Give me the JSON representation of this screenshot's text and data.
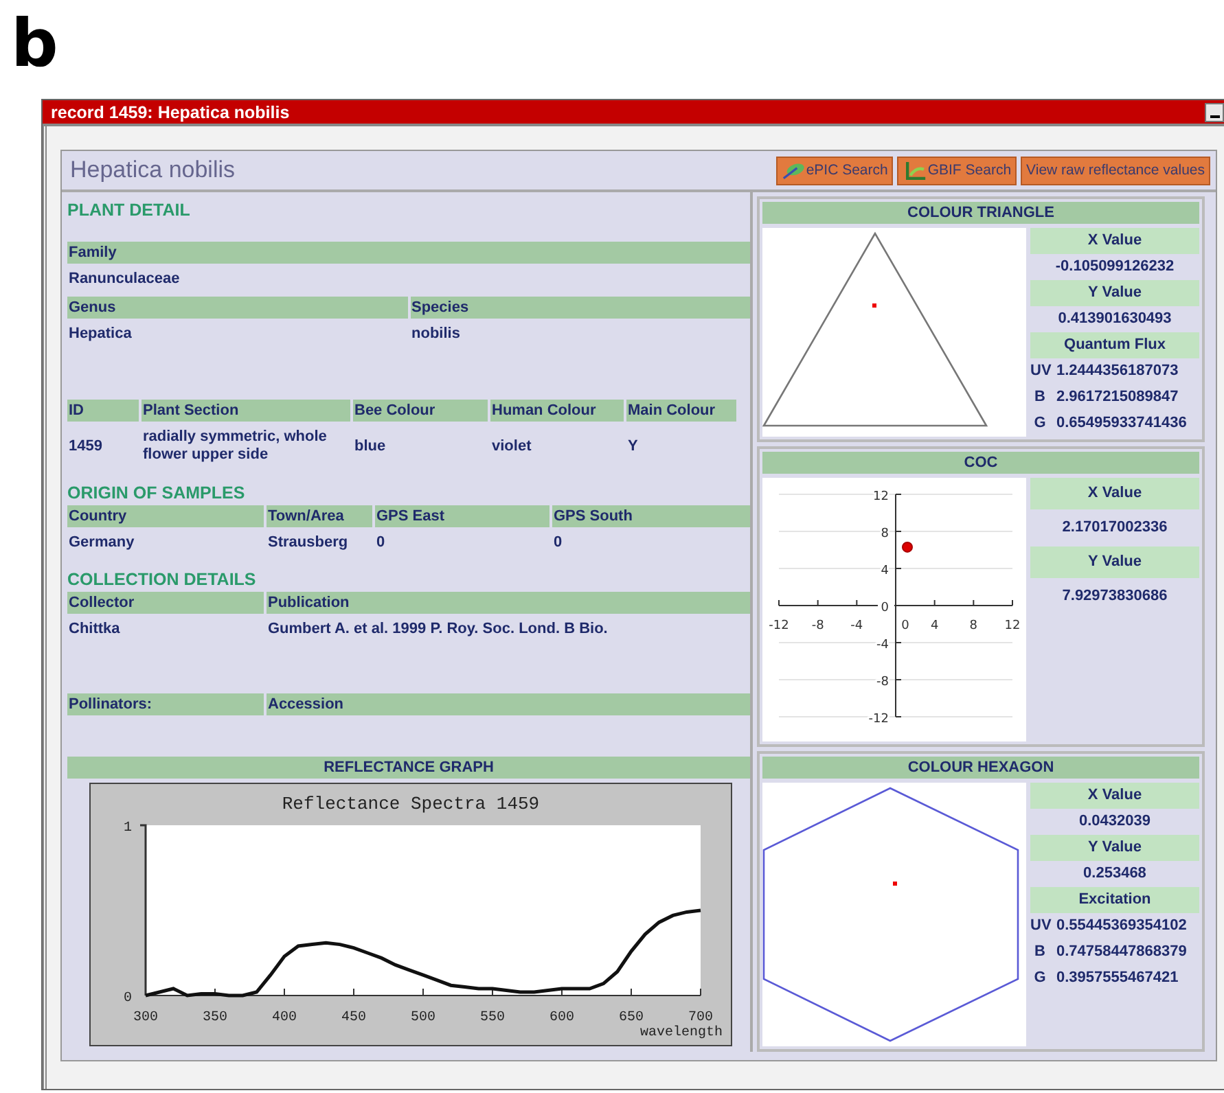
{
  "figure_label": "b",
  "window": {
    "title": "record 1459: Hepatica nobilis"
  },
  "header": {
    "title": "Hepatica nobilis",
    "buttons": [
      {
        "label": "ePIC Search",
        "kind": "epic"
      },
      {
        "label": "GBIF Search",
        "kind": "gbif"
      },
      {
        "label": "View raw reflectance values",
        "kind": "plain"
      }
    ]
  },
  "sections": [
    {
      "heading": "PLANT DETAIL",
      "tables": [
        {
          "columns": [
            "Family"
          ],
          "values": [
            "Ranunculaceae"
          ]
        },
        {
          "columns": [
            "Genus",
            "Species"
          ],
          "values": [
            "Hepatica",
            "nobilis"
          ]
        },
        {
          "columns": [
            "ID",
            "Plant Section",
            "Bee Colour",
            "Human Colour",
            "Main Colour"
          ],
          "values": [
            "1459",
            "radially symmetric, whole flower upper side",
            "blue",
            "violet",
            "Y"
          ]
        }
      ]
    },
    {
      "heading": "ORIGIN OF SAMPLES",
      "tables": [
        {
          "columns": [
            "Country",
            "Town/Area",
            "GPS East",
            "GPS South"
          ],
          "values": [
            "Germany",
            "Strausberg",
            "0",
            "0"
          ]
        }
      ]
    },
    {
      "heading": "COLLECTION DETAILS",
      "tables": [
        {
          "columns": [
            "Collector",
            "Publication"
          ],
          "values": [
            "Chittka",
            "Gumbert A. et al. 1999 P. Roy. Soc. Lond. B Bio."
          ]
        },
        {
          "columns": [
            "Pollinators:",
            "Accession"
          ]
        }
      ]
    }
  ],
  "reflectance": {
    "heading": "REFLECTANCE GRAPH",
    "chart_data": {
      "type": "line",
      "title": "Reflectance Spectra 1459",
      "xlabel": "wavelength",
      "x": [
        300,
        310,
        320,
        330,
        340,
        350,
        360,
        370,
        380,
        390,
        400,
        410,
        420,
        430,
        440,
        450,
        460,
        470,
        480,
        490,
        500,
        510,
        520,
        530,
        540,
        550,
        560,
        570,
        580,
        590,
        600,
        610,
        620,
        630,
        640,
        650,
        660,
        670,
        680,
        690,
        700
      ],
      "values": [
        0,
        0.02,
        0.04,
        0,
        0.01,
        0.01,
        0,
        0,
        0.02,
        0.12,
        0.23,
        0.29,
        0.3,
        0.31,
        0.3,
        0.28,
        0.25,
        0.22,
        0.18,
        0.15,
        0.12,
        0.09,
        0.06,
        0.05,
        0.04,
        0.04,
        0.03,
        0.02,
        0.02,
        0.03,
        0.04,
        0.04,
        0.04,
        0.07,
        0.14,
        0.26,
        0.36,
        0.43,
        0.47,
        0.49,
        0.5
      ],
      "xlim": [
        300,
        700
      ],
      "ylim": [
        0,
        1
      ],
      "xticks": [
        300,
        350,
        400,
        450,
        500,
        550,
        600,
        650,
        700
      ],
      "yticks": [
        0,
        1
      ]
    }
  },
  "panels": [
    {
      "title": "COLOUR TRIANGLE",
      "kind": "triangle",
      "fields": [
        {
          "kind": "heading",
          "text": "X Value"
        },
        {
          "kind": "value",
          "text": "-0.105099126232"
        },
        {
          "kind": "heading",
          "text": "Y Value"
        },
        {
          "kind": "value",
          "text": "0.413901630493"
        },
        {
          "kind": "heading",
          "text": "Quantum Flux"
        },
        {
          "kind": "channel",
          "label": "UV",
          "text": "1.2444356187073"
        },
        {
          "kind": "channel",
          "label": "B",
          "text": "2.9617215089847"
        },
        {
          "kind": "channel",
          "label": "G",
          "text": "0.65495933741436"
        }
      ]
    },
    {
      "title": "COC",
      "kind": "coc",
      "chart_data": {
        "type": "scatter",
        "x": [
          1.2
        ],
        "values": [
          6.3
        ],
        "xlim": [
          -12,
          12
        ],
        "ylim": [
          -12,
          12
        ],
        "xticks": [
          -12,
          -8,
          -4,
          0,
          4,
          8,
          12
        ],
        "yticks": [
          -12,
          -8,
          -4,
          0,
          4,
          8,
          12
        ],
        "grid": true
      },
      "fields": [
        {
          "kind": "heading",
          "text": "X Value"
        },
        {
          "kind": "value",
          "text": "2.17017002336"
        },
        {
          "kind": "heading",
          "text": "Y Value"
        },
        {
          "kind": "value",
          "text": "7.92973830686"
        }
      ]
    },
    {
      "title": "COLOUR HEXAGON",
      "kind": "hexagon",
      "fields": [
        {
          "kind": "heading",
          "text": "X Value"
        },
        {
          "kind": "value",
          "text": "0.0432039"
        },
        {
          "kind": "heading",
          "text": "Y Value"
        },
        {
          "kind": "value",
          "text": "0.253468"
        },
        {
          "kind": "heading",
          "text": "Excitation"
        },
        {
          "kind": "channel",
          "label": "UV",
          "text": "0.55445369354102"
        },
        {
          "kind": "channel",
          "label": "B",
          "text": "0.74758447868379"
        },
        {
          "kind": "channel",
          "label": "G",
          "text": "0.3957555467421"
        }
      ]
    }
  ]
}
